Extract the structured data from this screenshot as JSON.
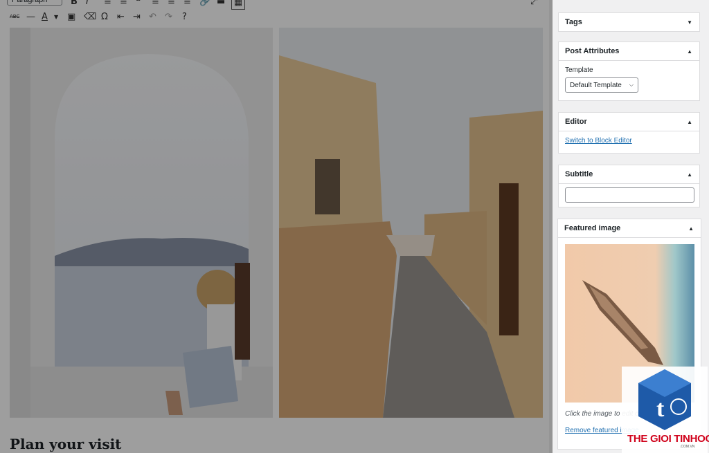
{
  "toolbar": {
    "format_value": "Paragraph",
    "row1_icons": [
      "bold-icon",
      "italic-icon",
      "bullet-list-icon",
      "numbered-list-icon",
      "blockquote-icon",
      "align-left-icon",
      "align-center-icon",
      "align-right-icon",
      "link-icon",
      "read-more-icon",
      "toolbar-toggle-icon"
    ],
    "row2_icons": [
      "strikethrough-icon",
      "horizontal-line-icon",
      "text-color-icon",
      "paste-as-text-icon",
      "clear-formatting-icon",
      "special-character-icon",
      "outdent-icon",
      "indent-icon",
      "undo-icon",
      "redo-icon",
      "help-icon"
    ]
  },
  "editor": {
    "heading": "Plan your visit"
  },
  "sidebar": {
    "tags": {
      "title": "Tags"
    },
    "post_attributes": {
      "title": "Post Attributes",
      "template_label": "Template",
      "template_value": "Default Template"
    },
    "editor_panel": {
      "title": "Editor",
      "switch_link": "Switch to Block Editor"
    },
    "subtitle": {
      "title": "Subtitle",
      "value": ""
    },
    "featured_image": {
      "title": "Featured image",
      "caption": "Click the image to edit or update",
      "remove_link": "Remove featured image"
    }
  },
  "watermark": {
    "brand": "THE GIOI TINHOC",
    "domain": ".COM.VN"
  },
  "colors": {
    "link": "#2271b1",
    "panel_border": "#dcdcde",
    "watermark_red": "#d0021b",
    "watermark_blue": "#1e5aa8"
  }
}
